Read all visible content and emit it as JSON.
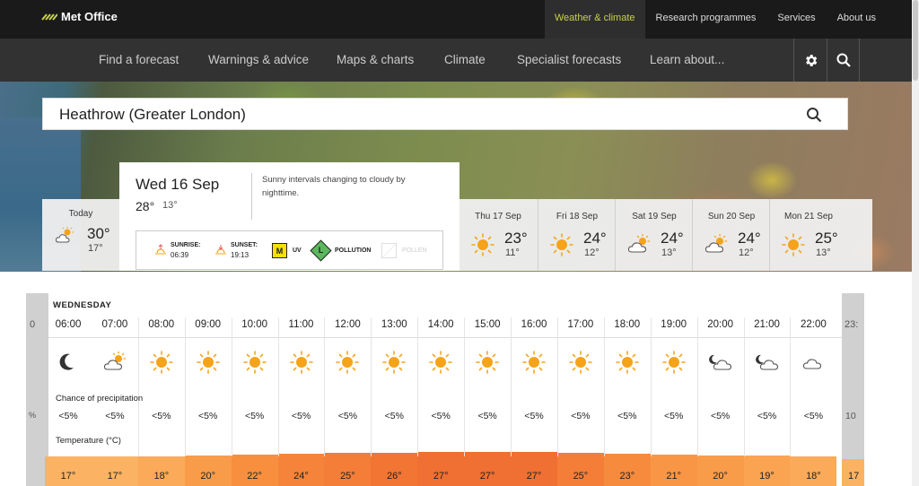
{
  "header": {
    "logo_text": "Met Office",
    "top_nav": [
      "Weather & climate",
      "Research programmes",
      "Services",
      "About us"
    ],
    "main_nav": [
      "Find a forecast",
      "Warnings & advice",
      "Maps & charts",
      "Climate",
      "Specialist forecasts",
      "Learn about..."
    ]
  },
  "search": {
    "location": "Heathrow (Greater London)"
  },
  "today_card": {
    "label": "Today",
    "icon": "sun-cloud-icon",
    "max": "30°",
    "min": "17°"
  },
  "selected_day": {
    "date": "Wed 16 Sep",
    "max": "28°",
    "min": "13°",
    "summary": "Sunny intervals changing to cloudy by nighttime.",
    "sunrise_label": "SUNRISE:",
    "sunrise": "06:39",
    "sunset_label": "SUNSET:",
    "sunset": "19:13",
    "uv_badge": "M",
    "uv_label": "UV",
    "pollution_badge": "L",
    "pollution_label": "POLLUTION",
    "pollen_label": "POLLEN"
  },
  "forecast_days": [
    {
      "label": "Thu 17 Sep",
      "icon": "sun-icon",
      "max": "23°",
      "min": "11°"
    },
    {
      "label": "Fri 18 Sep",
      "icon": "sun-icon",
      "max": "24°",
      "min": "12°"
    },
    {
      "label": "Sat 19 Sep",
      "icon": "sun-cloud-icon",
      "max": "24°",
      "min": "13°"
    },
    {
      "label": "Sun 20 Sep",
      "icon": "sun-cloud-icon",
      "max": "24°",
      "min": "12°"
    },
    {
      "label": "Mon 21 Sep",
      "icon": "sun-icon",
      "max": "25°",
      "min": "13°"
    }
  ],
  "hourly": {
    "day_name": "WEDNESDAY",
    "precip_label": "Chance of precipitation",
    "temp_label": "Temperature (°C)",
    "left_edge_time": "0",
    "left_edge_precip": "%",
    "right_edge_time": "23:",
    "right_edge_precip": "10",
    "right_edge_temp": "17",
    "hours": [
      {
        "time": "06:00",
        "icon": "moon-icon",
        "precip": "<5%",
        "temp": "17°",
        "color": "#fbb363"
      },
      {
        "time": "07:00",
        "icon": "sun-cloud-icon",
        "precip": "<5%",
        "temp": "17°",
        "color": "#fbb363"
      },
      {
        "time": "08:00",
        "icon": "sun-icon",
        "precip": "<5%",
        "temp": "18°",
        "color": "#faaa58"
      },
      {
        "time": "09:00",
        "icon": "sun-icon",
        "precip": "<5%",
        "temp": "20°",
        "color": "#f99c4a"
      },
      {
        "time": "10:00",
        "icon": "sun-icon",
        "precip": "<5%",
        "temp": "22°",
        "color": "#f78f3f"
      },
      {
        "time": "11:00",
        "icon": "sun-icon",
        "precip": "<5%",
        "temp": "24°",
        "color": "#f5843a"
      },
      {
        "time": "12:00",
        "icon": "sun-icon",
        "precip": "<5%",
        "temp": "25°",
        "color": "#f47e38"
      },
      {
        "time": "13:00",
        "icon": "sun-icon",
        "precip": "<5%",
        "temp": "26°",
        "color": "#f27534"
      },
      {
        "time": "14:00",
        "icon": "sun-icon",
        "precip": "<5%",
        "temp": "27°",
        "color": "#f06f32"
      },
      {
        "time": "15:00",
        "icon": "sun-icon",
        "precip": "<5%",
        "temp": "27°",
        "color": "#f06f32"
      },
      {
        "time": "16:00",
        "icon": "sun-icon",
        "precip": "<5%",
        "temp": "27°",
        "color": "#f06f32"
      },
      {
        "time": "17:00",
        "icon": "sun-icon",
        "precip": "<5%",
        "temp": "25°",
        "color": "#f47e38"
      },
      {
        "time": "18:00",
        "icon": "sun-icon",
        "precip": "<5%",
        "temp": "23°",
        "color": "#f68a3d"
      },
      {
        "time": "19:00",
        "icon": "sun-icon",
        "precip": "<5%",
        "temp": "21°",
        "color": "#f89646"
      },
      {
        "time": "20:00",
        "icon": "moon-cloud-icon",
        "precip": "<5%",
        "temp": "20°",
        "color": "#f99c4a"
      },
      {
        "time": "21:00",
        "icon": "moon-cloud-icon",
        "precip": "<5%",
        "temp": "19°",
        "color": "#faa452"
      },
      {
        "time": "22:00",
        "icon": "cloud-icon",
        "precip": "<5%",
        "temp": "18°",
        "color": "#faaa58"
      }
    ]
  },
  "colors": {
    "accent": "#c8d24a",
    "sun": "#f5a31a",
    "uv": "#f5e000",
    "pollution": "#5cb85c"
  }
}
